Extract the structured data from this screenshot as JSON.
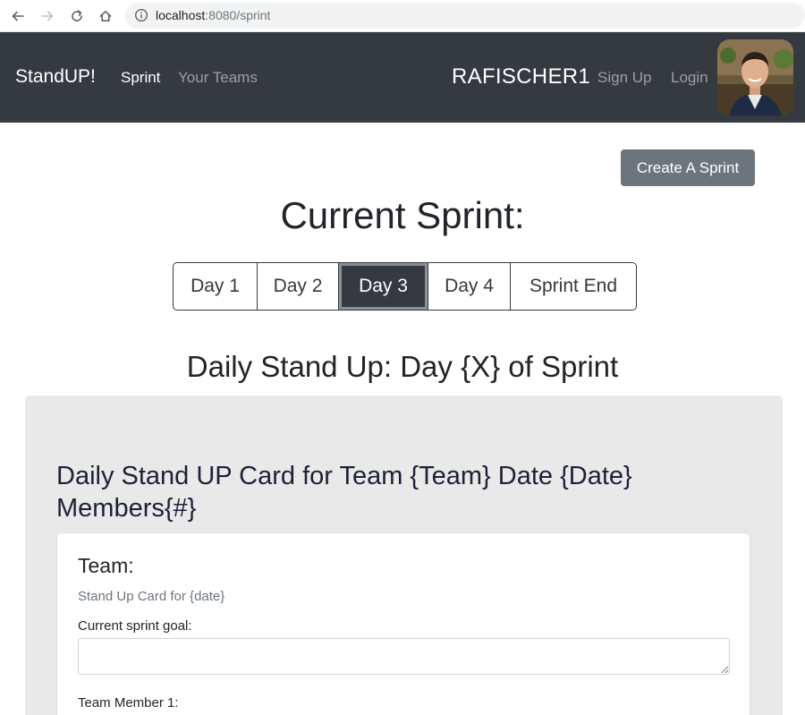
{
  "browser": {
    "url_host": "localhost",
    "url_path": ":8080/sprint"
  },
  "navbar": {
    "brand": "StandUP!",
    "links": [
      "Sprint",
      "Your Teams"
    ],
    "username": "RAFISCHER1",
    "auth_links": [
      "Sign Up",
      "Login"
    ]
  },
  "actions": {
    "create_sprint": "Create A Sprint"
  },
  "page": {
    "title": "Current Sprint:",
    "days": [
      "Day 1",
      "Day 2",
      "Day 3",
      "Day 4",
      "Sprint End"
    ],
    "selected_day": "Day 3",
    "section_title": "Daily Stand Up: Day {X} of Sprint"
  },
  "standup": {
    "heading": "Daily Stand UP Card for Team {Team} Date {Date} Members{#}",
    "card": {
      "title": "Team:",
      "subtitle": "Stand Up Card for {date}",
      "goal_label": "Current sprint goal:",
      "goal_value": "",
      "member_label": "Team Member 1:"
    }
  },
  "colors": {
    "navbar_bg": "#343a40",
    "button_secondary": "#6c757d",
    "panel_bg": "#e9e9e9"
  }
}
